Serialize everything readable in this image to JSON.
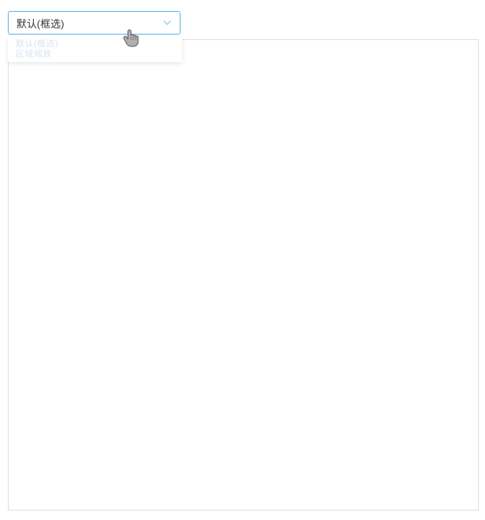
{
  "select": {
    "label": "默认(框选)"
  },
  "dropdown": {
    "line1": "默认(框选)",
    "line2": "区域缩放"
  }
}
